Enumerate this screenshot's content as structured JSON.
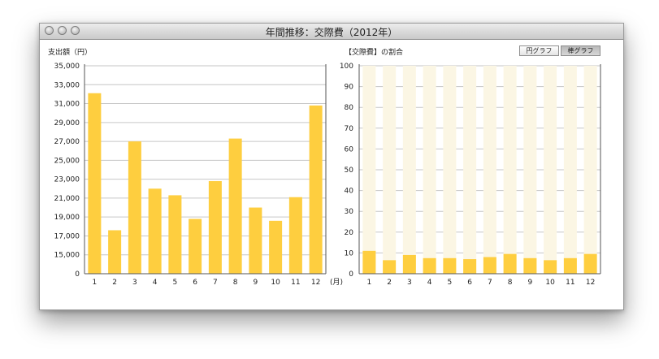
{
  "window": {
    "title": "年間推移：交際費（2012年）"
  },
  "left_panel": {
    "title": "支出額（円）",
    "x_unit": "(月)"
  },
  "right_panel": {
    "title": "【交際費】の割合",
    "buttons": {
      "pie": "円グラフ",
      "bar": "棒グラフ"
    },
    "selected": "bar"
  },
  "colors": {
    "bar": "#FECE3F",
    "track": "#FBF6E4",
    "grid": "#c6c6c6"
  },
  "chart_data": [
    {
      "type": "bar",
      "title": "支出額（円）",
      "xlabel": "(月)",
      "ylabel": "",
      "categories": [
        "1",
        "2",
        "3",
        "4",
        "5",
        "6",
        "7",
        "8",
        "9",
        "10",
        "11",
        "12"
      ],
      "values": [
        32100,
        17600,
        27000,
        22000,
        21300,
        18800,
        22800,
        27300,
        20000,
        18600,
        21100,
        30800
      ],
      "ylim": [
        13000,
        35000
      ],
      "y_ticks": [
        "0",
        "15,000",
        "17,000",
        "19,000",
        "21,000",
        "23,000",
        "25,000",
        "27,000",
        "29,000",
        "31,000",
        "33,000",
        "35,000"
      ],
      "grid": true
    },
    {
      "type": "bar",
      "title": "【交際費】の割合",
      "xlabel": "",
      "ylabel": "",
      "categories": [
        "1",
        "2",
        "3",
        "4",
        "5",
        "6",
        "7",
        "8",
        "9",
        "10",
        "11",
        "12"
      ],
      "values": [
        11,
        6.5,
        9,
        7.5,
        7.5,
        7,
        8,
        9.5,
        7.5,
        6.5,
        7.5,
        9.5
      ],
      "ylim": [
        0,
        100
      ],
      "y_ticks": [
        "0",
        "10",
        "20",
        "30",
        "40",
        "50",
        "60",
        "70",
        "80",
        "90",
        "100"
      ],
      "grid": true
    }
  ]
}
